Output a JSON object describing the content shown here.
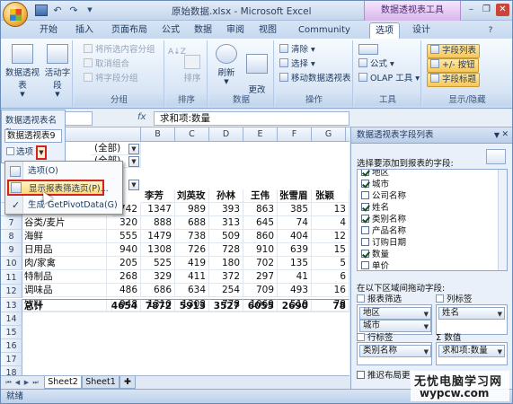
{
  "window": {
    "title": "原始数据.xlsx - Microsoft Excel",
    "context_tab_group": "数据透视表工具"
  },
  "tabs": [
    "开始",
    "插入",
    "页面布局",
    "公式",
    "数据",
    "审阅",
    "视图",
    "Community Clips",
    "选项",
    "设计"
  ],
  "ribbon": {
    "pivottable_btn": "数据透视表",
    "active_field_btn": "活动字段",
    "group_selection": "将所选内容分组",
    "ungroup": "取消组合",
    "group_field": "将字段分组",
    "group_label": "分组",
    "sort_btn": "排序",
    "sort_label": "排序",
    "refresh_btn": "刷新",
    "change_source_btn": "更改\n数据源",
    "data_label": "数据",
    "clear": "清除",
    "select": "选择",
    "move_pt": "移动数据透视表",
    "actions_label": "操作",
    "formula": "公式",
    "olap": "OLAP 工具",
    "tools_label": "工具",
    "field_list": "字段列表",
    "plus_minus": "+/- 按钮",
    "field_headers": "字段标题",
    "show_hide_label": "显示/隐藏"
  },
  "formula_bar": {
    "fx": "fx",
    "content": "求和项:数量"
  },
  "pt_name_panel": {
    "label": "数据透视表名称:",
    "name": "数据透视表9",
    "options": "选项"
  },
  "menu": {
    "items": [
      "选项(O)",
      "显示报表筛选页(P)...",
      "生成 GetPivotData(G)"
    ]
  },
  "columns": [
    "B",
    "C",
    "D",
    "E",
    "F",
    "G",
    "H"
  ],
  "rows": [
    "1",
    "2",
    "3",
    "4",
    "5",
    "6",
    "7",
    "8",
    "9",
    "10",
    "11",
    "12",
    "13",
    "14",
    "15",
    "16",
    "17",
    "18",
    "19",
    "20",
    "21",
    "22",
    "23",
    "24",
    "25"
  ],
  "filters": [
    "(全部)",
    "(全部)"
  ],
  "sheet": {
    "headers": [
      "李芳",
      "刘英玫",
      "孙林",
      "王伟",
      "张雪眉",
      "张颖"
    ],
    "categories": [
      {
        "label": "谷类/麦片",
        "values": [
          "320",
          "888",
          "688",
          "313",
          "645",
          "74"
        ]
      },
      {
        "label": "海鲜",
        "values": [
          "555",
          "1479",
          "738",
          "509",
          "860",
          "404"
        ]
      },
      {
        "label": "日用品",
        "values": [
          "940",
          "1308",
          "726",
          "728",
          "910",
          "639"
        ]
      },
      {
        "label": "肉/家禽",
        "values": [
          "205",
          "525",
          "419",
          "180",
          "702",
          "135"
        ]
      },
      {
        "label": "特制品",
        "values": [
          "268",
          "329",
          "411",
          "372",
          "297",
          "41"
        ]
      },
      {
        "label": "调味品",
        "values": [
          "486",
          "686",
          "634",
          "254",
          "709",
          "493"
        ]
      },
      {
        "label": "饮料",
        "values": [
          "948",
          "1310",
          "1308",
          "778",
          "1069",
          "519"
        ]
      }
    ],
    "row6_values": [
      "742",
      "1347",
      "989",
      "393",
      "863",
      "385"
    ],
    "total_label": "总计",
    "total_values": [
      "4654",
      "7872",
      "5913",
      "3527",
      "6055",
      "2690"
    ],
    "right_edge": [
      "13",
      "4",
      "12",
      "15",
      "5",
      "6",
      "16",
      "78"
    ]
  },
  "sheet_tabs": [
    "Sheet2",
    "Sheet1"
  ],
  "status": "就绪",
  "field_list": {
    "title": "数据透视表字段列表",
    "choose_label": "选择要添加到报表的字段:",
    "fields": [
      {
        "name": "地区",
        "checked": true
      },
      {
        "name": "城市",
        "checked": true
      },
      {
        "name": "公司名称",
        "checked": false
      },
      {
        "name": "姓名",
        "checked": true
      },
      {
        "name": "类别名称",
        "checked": true
      },
      {
        "name": "产品名称",
        "checked": false
      },
      {
        "name": "订购日期",
        "checked": false
      },
      {
        "name": "数量",
        "checked": true
      },
      {
        "name": "单价",
        "checked": false
      }
    ],
    "drag_label": "在以下区域间拖动字段:",
    "report_filter": "报表筛选",
    "column_labels": "列标签",
    "row_labels": "行标签",
    "values": "数值",
    "filter_items": [
      "地区",
      "城市"
    ],
    "column_items": [
      "姓名"
    ],
    "row_items": [
      "类别名称"
    ],
    "value_items": [
      "求和项:数量"
    ],
    "defer_label": "推迟布局更"
  },
  "watermark": {
    "line1": "无忧电脑学习网",
    "line2": "wypcw.com"
  }
}
